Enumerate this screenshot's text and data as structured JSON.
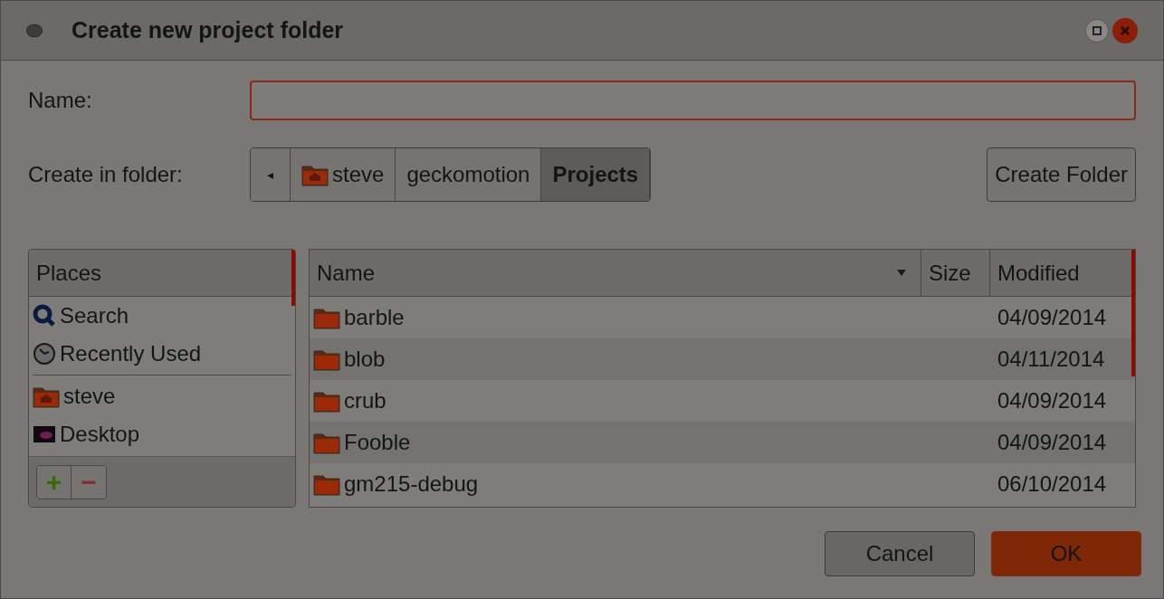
{
  "window": {
    "title": "Create new project folder"
  },
  "name_field": {
    "label": "Name:"
  },
  "location": {
    "label": "Create in folder:",
    "back": "◂",
    "path": [
      {
        "label": "steve",
        "kind": "home",
        "selected": false
      },
      {
        "label": "geckomotion",
        "kind": "folder",
        "selected": false
      },
      {
        "label": "Projects",
        "kind": "folder",
        "selected": true
      }
    ]
  },
  "create_folder_button": "Create Folder",
  "places": {
    "heading": "Places",
    "items": [
      {
        "label": "Search",
        "kind": "search"
      },
      {
        "label": "Recently Used",
        "kind": "recent"
      },
      {
        "label": "steve",
        "kind": "home"
      },
      {
        "label": "Desktop",
        "kind": "desktop"
      }
    ],
    "add": "+",
    "remove": "−"
  },
  "files": {
    "columns": [
      "Name",
      "Size",
      "Modified"
    ],
    "rows": [
      {
        "name": "barble",
        "modified": "04/09/2014"
      },
      {
        "name": "blob",
        "modified": "04/11/2014"
      },
      {
        "name": "crub",
        "modified": "04/09/2014"
      },
      {
        "name": "Fooble",
        "modified": "04/09/2014"
      },
      {
        "name": "gm215-debug",
        "modified": "06/10/2014"
      }
    ]
  },
  "buttons": [
    {
      "label": "Cancel",
      "kind": "normal"
    },
    {
      "label": "OK",
      "kind": "default"
    }
  ]
}
